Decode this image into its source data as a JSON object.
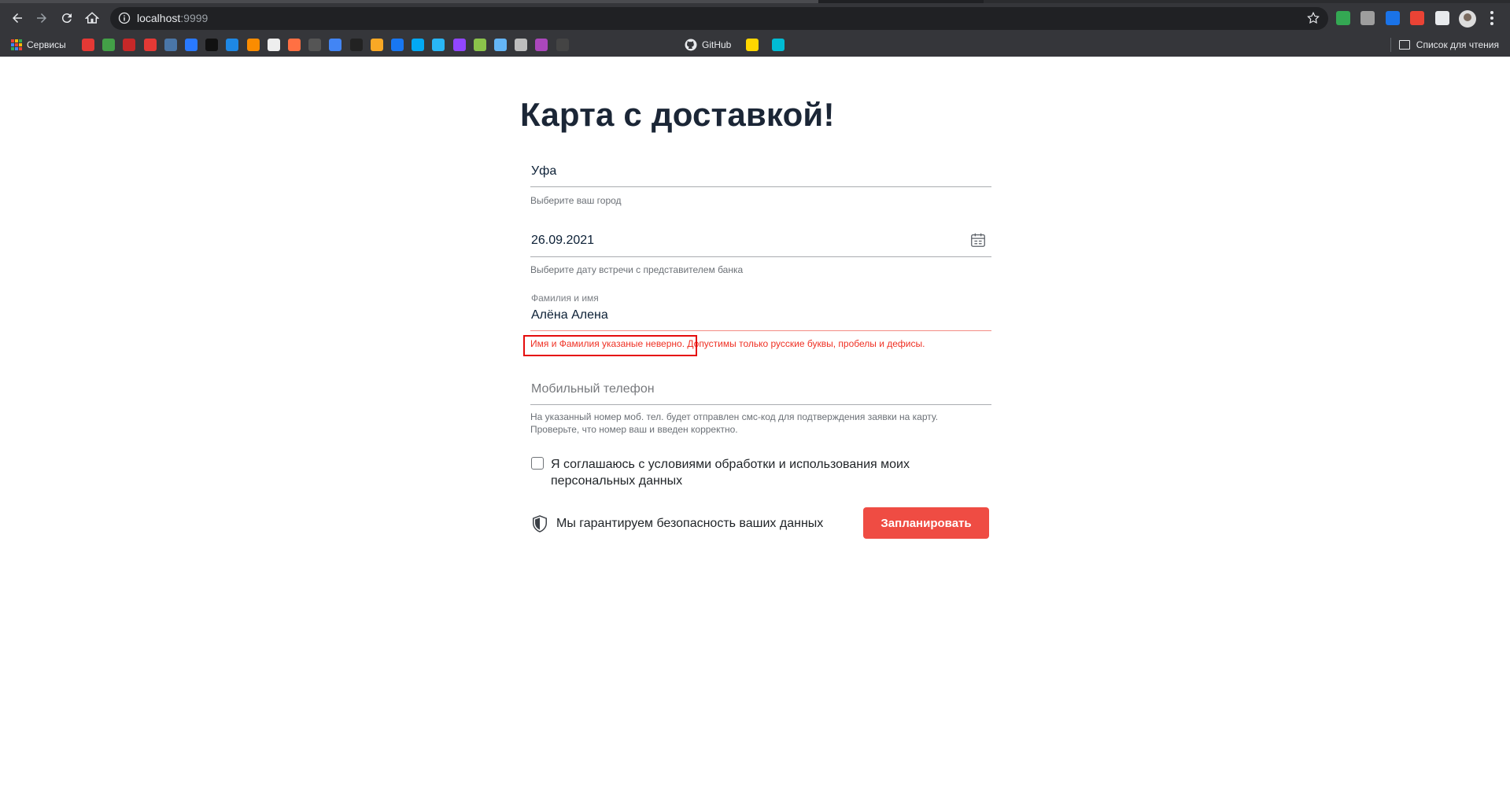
{
  "browser": {
    "url_host": "localhost",
    "url_port": ":9999",
    "bookmarks": {
      "services_label": "Сервисы",
      "github_label": "GitHub",
      "reading_list_label": "Список для чтения",
      "icons": [
        {
          "name": "bookmark-generic-1-icon",
          "color": "#e53935"
        },
        {
          "name": "bookmark-generic-2-icon",
          "color": "#43a047"
        },
        {
          "name": "bookmark-generic-3-icon",
          "color": "#c62828"
        },
        {
          "name": "bookmark-generic-4-icon",
          "color": "#e53935"
        },
        {
          "name": "vk-icon",
          "color": "#4a76a8"
        },
        {
          "name": "bookmark-4-icon",
          "color": "#2979ff"
        },
        {
          "name": "bookmark-s-icon",
          "color": "#111111"
        },
        {
          "name": "mail-icon",
          "color": "#1e88e5"
        },
        {
          "name": "bookmark-orange-icon",
          "color": "#fb8c00"
        },
        {
          "name": "bookmark-red-box-icon",
          "color": "#eeeeee"
        },
        {
          "name": "bookmark-orange-fox-icon",
          "color": "#ff7043"
        },
        {
          "name": "bookmark-dark-icon",
          "color": "#555555"
        },
        {
          "name": "translate-icon",
          "color": "#4285f4"
        },
        {
          "name": "bookmark-bl-icon",
          "color": "#222222"
        },
        {
          "name": "bookmark-yellow-icon",
          "color": "#f9a825"
        },
        {
          "name": "facebook-icon",
          "color": "#1877f2"
        },
        {
          "name": "bookmark-blue-arrow-icon",
          "color": "#03a9f4"
        },
        {
          "name": "bookmark-blue-circle-icon",
          "color": "#29b6f6"
        },
        {
          "name": "twitch-icon",
          "color": "#9146ff"
        },
        {
          "name": "bookmark-green-plane-icon",
          "color": "#8bc34a"
        },
        {
          "name": "bookmark-star-icon",
          "color": "#64b5f6"
        },
        {
          "name": "bookmark-grid-icon",
          "color": "#bdbdbd"
        },
        {
          "name": "bookmark-colorful-icon",
          "color": "#ab47bc"
        },
        {
          "name": "bookmark-github-dark-icon",
          "color": "#444444"
        }
      ],
      "after_github_icons": [
        {
          "name": "bookmark-tv-icon",
          "color": "#ffd600"
        },
        {
          "name": "bookmark-cyan-icon",
          "color": "#00bcd4"
        }
      ]
    },
    "extensions": [
      {
        "name": "shield-extension-icon",
        "color": "#34a853"
      },
      {
        "name": "extension-gray-icon",
        "color": "#9e9e9e"
      },
      {
        "name": "extension-blue-icon",
        "color": "#1a73e8"
      },
      {
        "name": "extension-card-icon",
        "color": "#ea4335"
      },
      {
        "name": "puzzle-icon",
        "color": "#e8eaed"
      }
    ]
  },
  "page": {
    "title": "Карта с доставкой!",
    "city": {
      "value": "Уфа",
      "hint": "Выберите ваш город"
    },
    "date": {
      "value": "26.09.2021",
      "hint": "Выберите дату встречи с представителем банка"
    },
    "name": {
      "label": "Фамилия и имя",
      "value": "Алёна Алена",
      "error": "Имя и Фамилия указаные неверно. Допустимы только русские буквы, пробелы и дефисы."
    },
    "phone": {
      "placeholder": "Мобильный телефон",
      "hint_line1": "На указанный номер моб. тел. будет отправлен смс-код для подтверждения заявки на карту.",
      "hint_line2": "Проверьте, что номер ваш и введен корректно."
    },
    "agreement": {
      "checked": false,
      "text": "Я соглашаюсь с условиями обработки и использования моих персональных данных"
    },
    "security_note": "Мы гарантируем безопасность ваших данных",
    "submit_label": "Запланировать",
    "colors": {
      "accent": "#ef4c43",
      "error": "#ef3124",
      "highlight": "#e50c0c"
    }
  }
}
